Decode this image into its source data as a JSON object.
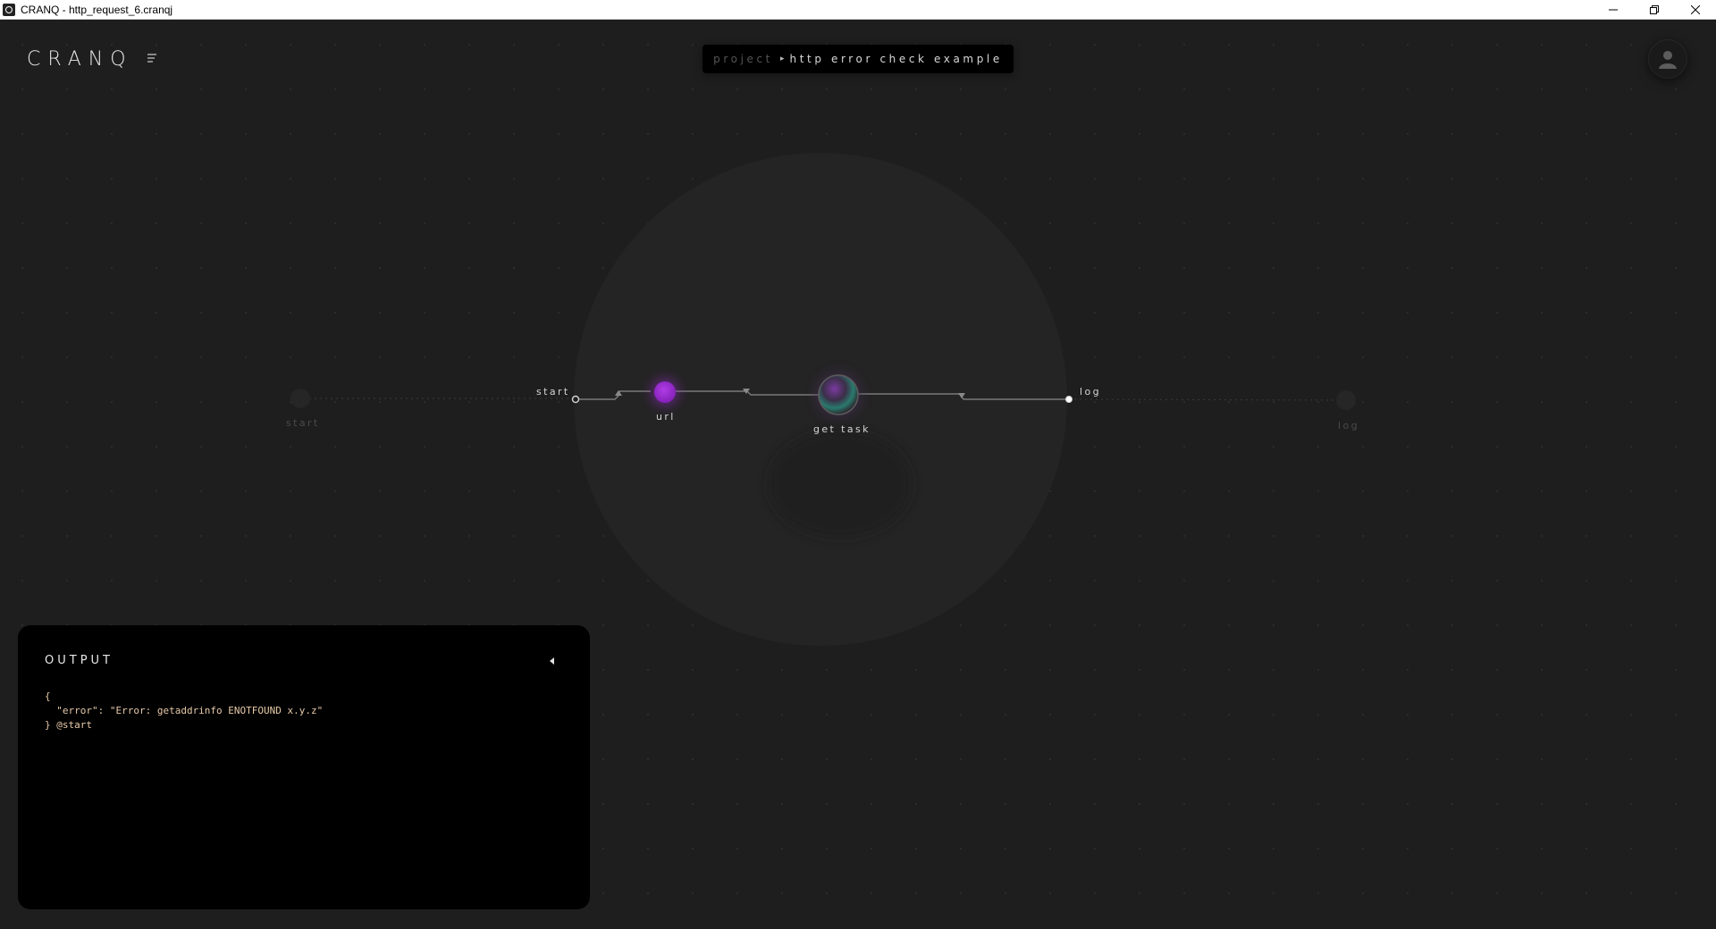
{
  "window": {
    "title": "CRANQ - http_request_6.cranqj"
  },
  "app": {
    "logo": "CRANQ"
  },
  "breadcrumb": {
    "project": "project",
    "current": "http error check example"
  },
  "graph": {
    "outer_input_label": "start",
    "outer_output_label": "log",
    "inner_input_label": "start",
    "inner_output_label": "log",
    "nodes": [
      {
        "label": "url",
        "color": "#9b2bd1"
      },
      {
        "label": "get task",
        "color": "#3d3a44"
      }
    ]
  },
  "output": {
    "title": "OUTPUT",
    "body": "{\n  \"error\": \"Error: getaddrinfo ENOTFOUND x.y.z\"\n} @start"
  },
  "colors": {
    "background": "#1e1e1e",
    "panel": "#000000",
    "accent_purple": "#9b2bd1",
    "accent_teal": "#2a8a7a",
    "output_text": "#e7c9a9"
  }
}
